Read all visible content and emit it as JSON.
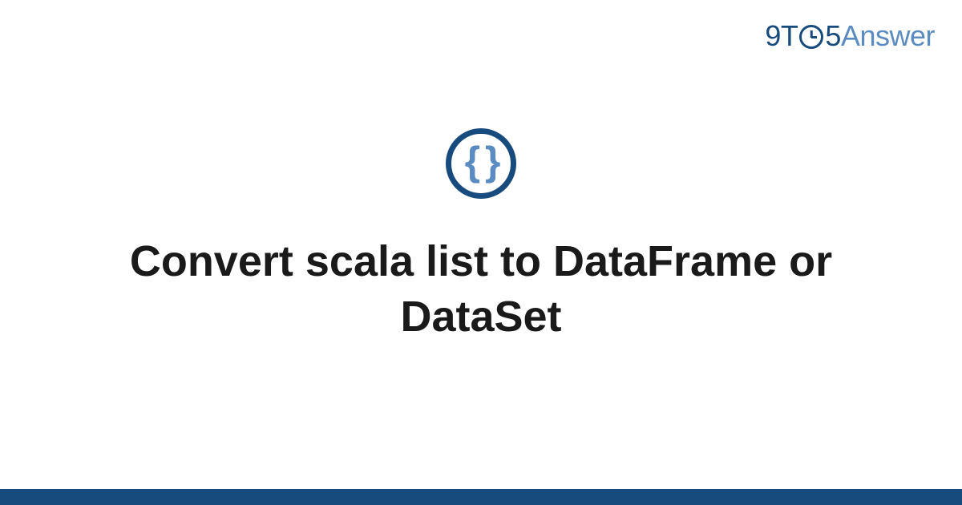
{
  "logo": {
    "part1": "9T",
    "part2": "5",
    "part3": "Answer"
  },
  "icon": {
    "glyph": "{ }"
  },
  "title": "Convert scala list to DataFrame or DataSet",
  "colors": {
    "primary": "#174b7d",
    "secondary": "#5b8cc1",
    "text": "#1a1a1a"
  }
}
